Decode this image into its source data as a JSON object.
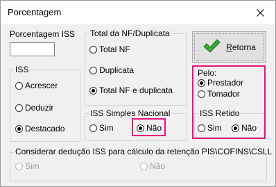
{
  "window": {
    "title": "Porcentagem",
    "close_icon": "close-icon"
  },
  "porcentagem_iss": {
    "label": "Porcentagem ISS",
    "value": ""
  },
  "iss_group": {
    "label": "ISS",
    "options": [
      {
        "label": "Acrescer",
        "checked": false
      },
      {
        "label": "Deduzir",
        "checked": false
      },
      {
        "label": "Destacado",
        "checked": true
      }
    ]
  },
  "total_group": {
    "label": "Total da NF/Duplicata",
    "options": [
      {
        "label": "Total NF",
        "checked": false
      },
      {
        "label": "Duplicata",
        "checked": false
      },
      {
        "label": "Total NF e duplicata",
        "checked": true
      }
    ]
  },
  "simples_group": {
    "label": "ISS Simples Nacional",
    "options": [
      {
        "label": "Sim",
        "checked": false
      },
      {
        "label": "Não",
        "checked": true
      }
    ]
  },
  "retorna_button": {
    "label": "Retorna",
    "icon": "checkmark-icon"
  },
  "pelo_group": {
    "label": "Pelo:",
    "options": [
      {
        "label": "Prestador",
        "checked": true
      },
      {
        "label": "Tomador",
        "checked": false
      }
    ]
  },
  "retido_group": {
    "label": "ISS Retido",
    "options": [
      {
        "label": "Sim",
        "checked": false
      },
      {
        "label": "Não",
        "checked": true
      }
    ]
  },
  "deducao_group": {
    "label": "Considerar dedução ISS para cálculo da retenção PIS\\COFINS\\CSLL",
    "options": [
      {
        "label": "Sim",
        "checked": false
      },
      {
        "label": "Não",
        "checked": false
      }
    ]
  },
  "colors": {
    "highlight": "#e8117f",
    "check_green": "#3da935"
  }
}
